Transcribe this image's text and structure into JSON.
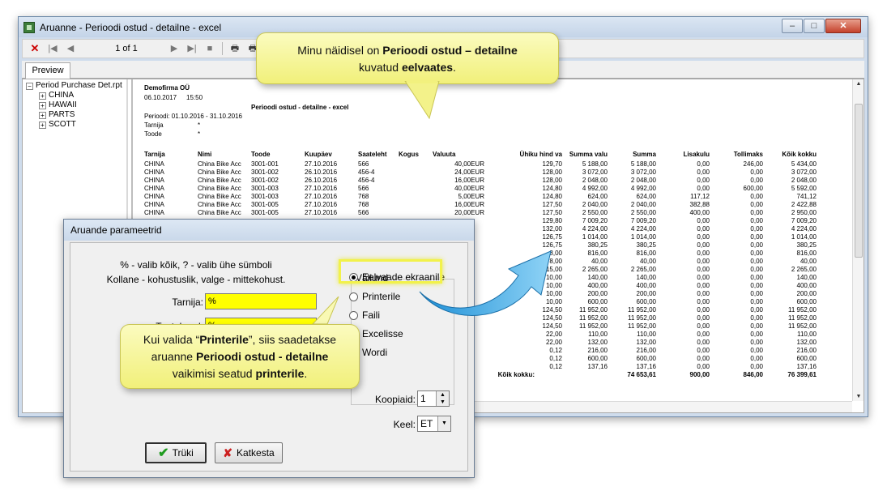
{
  "window": {
    "title": "Aruanne - Perioodi ostud - detailne - excel",
    "buttons": {
      "minimize": "–",
      "maximize": "□",
      "close": "✕"
    }
  },
  "toolbar": {
    "close": "✕",
    "first": "|◀",
    "prev": "◀",
    "page": "1 of 1",
    "next": "▶",
    "last": "▶|",
    "stop": "■",
    "print": "🖶",
    "print_setup": "🖶",
    "export": "✉"
  },
  "tab": {
    "preview": "Preview"
  },
  "tree": {
    "root": "Period Purchase Det.rpt",
    "items": [
      "CHINA",
      "HAWAII",
      "PARTS",
      "SCOTT"
    ]
  },
  "report": {
    "company": "Demofirma OÜ",
    "date": "06.10.2017",
    "time": "15:50",
    "title": "Perioodi ostud - detailne - excel",
    "period": "Perioodi: 01.10.2016 - 31.10.2016",
    "filter1_label": "Tarnija",
    "filter1_value": "*",
    "filter2_label": "Toode",
    "filter2_value": "*",
    "columns": [
      "Tarnija",
      "Nimi",
      "Toode",
      "Kuupäev",
      "Saateleht",
      "Kogus",
      "Valuuta",
      "Ühiku hind va",
      "Summa valu",
      "Summa",
      "Lisakulu",
      "Tollimaks",
      "Kõik kokku"
    ],
    "rows": [
      [
        "CHINA",
        "China Bike Acc",
        "3001-001",
        "27.10.2016",
        "566",
        "",
        "40,00EUR",
        "129,70",
        "5 188,00",
        "5 188,00",
        "0,00",
        "246,00",
        "5 434,00"
      ],
      [
        "CHINA",
        "China Bike Acc",
        "3001-002",
        "26.10.2016",
        "456-4",
        "",
        "24,00EUR",
        "128,00",
        "3 072,00",
        "3 072,00",
        "0,00",
        "0,00",
        "3 072,00"
      ],
      [
        "CHINA",
        "China Bike Acc",
        "3001-002",
        "26.10.2016",
        "456-4",
        "",
        "16,00EUR",
        "128,00",
        "2 048,00",
        "2 048,00",
        "0,00",
        "0,00",
        "2 048,00"
      ],
      [
        "CHINA",
        "China Bike Acc",
        "3001-003",
        "27.10.2016",
        "566",
        "",
        "40,00EUR",
        "124,80",
        "4 992,00",
        "4 992,00",
        "0,00",
        "600,00",
        "5 592,00"
      ],
      [
        "CHINA",
        "China Bike Acc",
        "3001-003",
        "27.10.2016",
        "768",
        "",
        "5,00EUR",
        "124,80",
        "624,00",
        "624,00",
        "117,12",
        "0,00",
        "741,12"
      ],
      [
        "CHINA",
        "China Bike Acc",
        "3001-005",
        "27.10.2016",
        "768",
        "",
        "16,00EUR",
        "127,50",
        "2 040,00",
        "2 040,00",
        "382,88",
        "0,00",
        "2 422,88"
      ],
      [
        "CHINA",
        "China Bike Acc",
        "3001-005",
        "27.10.2016",
        "566",
        "",
        "20,00EUR",
        "127,50",
        "2 550,00",
        "2 550,00",
        "400,00",
        "0,00",
        "2 950,00"
      ],
      [
        "",
        "",
        "",
        "",
        "",
        "",
        "",
        "129,80",
        "7 009,20",
        "7 009,20",
        "0,00",
        "0,00",
        "7 009,20"
      ],
      [
        "",
        "",
        "",
        "",
        "",
        "",
        "",
        "132,00",
        "4 224,00",
        "4 224,00",
        "0,00",
        "0,00",
        "4 224,00"
      ],
      [
        "",
        "",
        "",
        "",
        "",
        "",
        "",
        "126,75",
        "1 014,00",
        "1 014,00",
        "0,00",
        "0,00",
        "1 014,00"
      ],
      [
        "",
        "",
        "",
        "",
        "",
        "",
        "",
        "126,75",
        "380,25",
        "380,25",
        "0,00",
        "0,00",
        "380,25"
      ],
      [
        "",
        "",
        "",
        "",
        "",
        "",
        "",
        "8,00",
        "816,00",
        "816,00",
        "0,00",
        "0,00",
        "816,00"
      ],
      [
        "",
        "",
        "",
        "",
        "",
        "",
        "",
        "8,00",
        "40,00",
        "40,00",
        "0,00",
        "0,00",
        "40,00"
      ],
      [
        "",
        "",
        "",
        "",
        "",
        "",
        "",
        "15,00",
        "2 265,00",
        "2 265,00",
        "0,00",
        "0,00",
        "2 265,00"
      ],
      [
        "",
        "",
        "",
        "",
        "",
        "",
        "",
        "10,00",
        "140,00",
        "140,00",
        "0,00",
        "0,00",
        "140,00"
      ],
      [
        "",
        "",
        "",
        "",
        "",
        "",
        "",
        "10,00",
        "400,00",
        "400,00",
        "0,00",
        "0,00",
        "400,00"
      ],
      [
        "",
        "",
        "",
        "",
        "",
        "",
        "",
        "10,00",
        "200,00",
        "200,00",
        "0,00",
        "0,00",
        "200,00"
      ],
      [
        "",
        "",
        "",
        "",
        "",
        "",
        "",
        "10,00",
        "600,00",
        "600,00",
        "0,00",
        "0,00",
        "600,00"
      ],
      [
        "",
        "",
        "",
        "",
        "",
        "",
        "",
        "124,50",
        "11 952,00",
        "11 952,00",
        "0,00",
        "0,00",
        "11 952,00"
      ],
      [
        "",
        "",
        "",
        "",
        "",
        "",
        "",
        "124,50",
        "11 952,00",
        "11 952,00",
        "0,00",
        "0,00",
        "11 952,00"
      ],
      [
        "",
        "",
        "",
        "",
        "",
        "",
        "",
        "124,50",
        "11 952,00",
        "11 952,00",
        "0,00",
        "0,00",
        "11 952,00"
      ],
      [
        "",
        "",
        "",
        "",
        "",
        "",
        "",
        "22,00",
        "110,00",
        "110,00",
        "0,00",
        "0,00",
        "110,00"
      ],
      [
        "",
        "",
        "",
        "",
        "",
        "",
        "",
        "22,00",
        "132,00",
        "132,00",
        "0,00",
        "0,00",
        "132,00"
      ],
      [
        "",
        "",
        "",
        "",
        "",
        "",
        "",
        "0,12",
        "216,00",
        "216,00",
        "0,00",
        "0,00",
        "216,00"
      ],
      [
        "",
        "",
        "",
        "",
        "",
        "",
        "",
        "0,12",
        "600,00",
        "600,00",
        "0,00",
        "0,00",
        "600,00"
      ],
      [
        "",
        "",
        "",
        "",
        "",
        "",
        "",
        "0,12",
        "137,16",
        "137,16",
        "0,00",
        "0,00",
        "137,16"
      ]
    ],
    "total_label": "Kõik kokku:",
    "total_summa": "74 653,61",
    "total_lisakulu": "900,00",
    "total_tollimaks": "846,00",
    "total_kokku": "76 399,61"
  },
  "dialog": {
    "title": "Aruande parameetrid",
    "hint1": "% - valib kõik, ? - valib ühe sümboli",
    "hint2": "Kollane - kohustuslik, valge - mittekohust.",
    "tarnija_label": "Tarnija:",
    "tarnija_value": "%",
    "tootekood_label": "Tootekood:",
    "tootekood_value": "%",
    "group_title": "Väljund",
    "radios": [
      "Eelvaade ekraanile",
      "Printerile",
      "Faili",
      "Excelisse",
      "Wordi"
    ],
    "koopiaid_label": "Koopiaid:",
    "koopiaid_value": "1",
    "keel_label": "Keel:",
    "keel_value": "ET",
    "print_button": "Trüki",
    "cancel_button": "Katkesta"
  },
  "callouts": {
    "top": {
      "pre": "Minu näidisel on ",
      "b1": "Perioodi ostud – detailne",
      "mid": "kuvatud ",
      "b2": "eelvaates",
      "post": "."
    },
    "bottom": {
      "l1_pre": "Kui valida “",
      "l1_b": "Printerile",
      "l1_post": "”, siis saadetakse",
      "l2_pre": "aruanne ",
      "l2_b": "Perioodi ostud - detailne",
      "l3_pre": "vaikimisi seatud ",
      "l3_b": "printerile",
      "l3_post": "."
    }
  }
}
